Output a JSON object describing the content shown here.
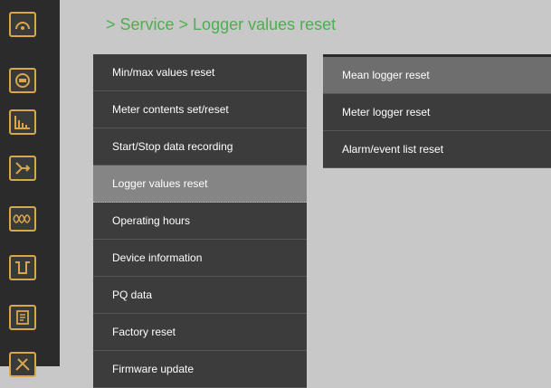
{
  "breadcrumb": "> Service > Logger values reset",
  "sidebar": {
    "icons": [
      "gauge-icon",
      "meter-icon",
      "bar-chart-icon",
      "branch-icon",
      "waveform-icon",
      "pulse-icon",
      "document-icon",
      "tools-icon"
    ]
  },
  "menu": {
    "items": [
      {
        "label": "Min/max values reset"
      },
      {
        "label": "Meter contents set/reset"
      },
      {
        "label": "Start/Stop data recording"
      },
      {
        "label": "Logger values reset",
        "active": true
      },
      {
        "label": "Operating hours"
      },
      {
        "label": "Device information"
      },
      {
        "label": "PQ data"
      },
      {
        "label": "Factory reset"
      },
      {
        "label": "Firmware update"
      }
    ]
  },
  "submenu": {
    "items": [
      {
        "label": "Mean logger reset",
        "active": true
      },
      {
        "label": "Meter logger reset"
      },
      {
        "label": "Alarm/event list reset"
      }
    ]
  },
  "colors": {
    "accent_green": "#4caf50",
    "icon_border": "#d9a74a",
    "menu_bg": "#3c3c3c",
    "active_bg": "#858585"
  }
}
